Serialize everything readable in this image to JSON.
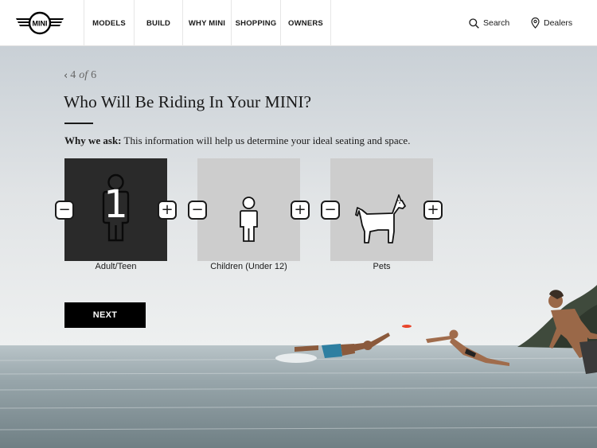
{
  "header": {
    "logo_text": "MINI",
    "nav": [
      {
        "label": "MODELS"
      },
      {
        "label": "BUILD"
      },
      {
        "label": "WHY MINI"
      },
      {
        "label": "SHOPPING"
      },
      {
        "label": "OWNERS"
      }
    ],
    "search_label": "Search",
    "dealers_label": "Dealers"
  },
  "progress": {
    "current": "4",
    "of": "of",
    "total": "6"
  },
  "question": {
    "title": "Who Will Be Riding In Your MINI?",
    "why_label": "Why we ask:",
    "why_text": "This information will help us determine your ideal seating and space."
  },
  "riders": [
    {
      "label": "Adult/Teen",
      "count": "1",
      "icon": "person-icon",
      "selected": true
    },
    {
      "label": "Children (Under 12)",
      "icon": "child-icon",
      "selected": false
    },
    {
      "label": "Pets",
      "icon": "dog-icon",
      "selected": false
    }
  ],
  "stepper": {
    "minus": "−",
    "plus": "+"
  },
  "next_label": "NEXT",
  "colors": {
    "selected_card": "#2a2a2a",
    "unselected_card": "#cdcdcd",
    "button": "#000000"
  }
}
